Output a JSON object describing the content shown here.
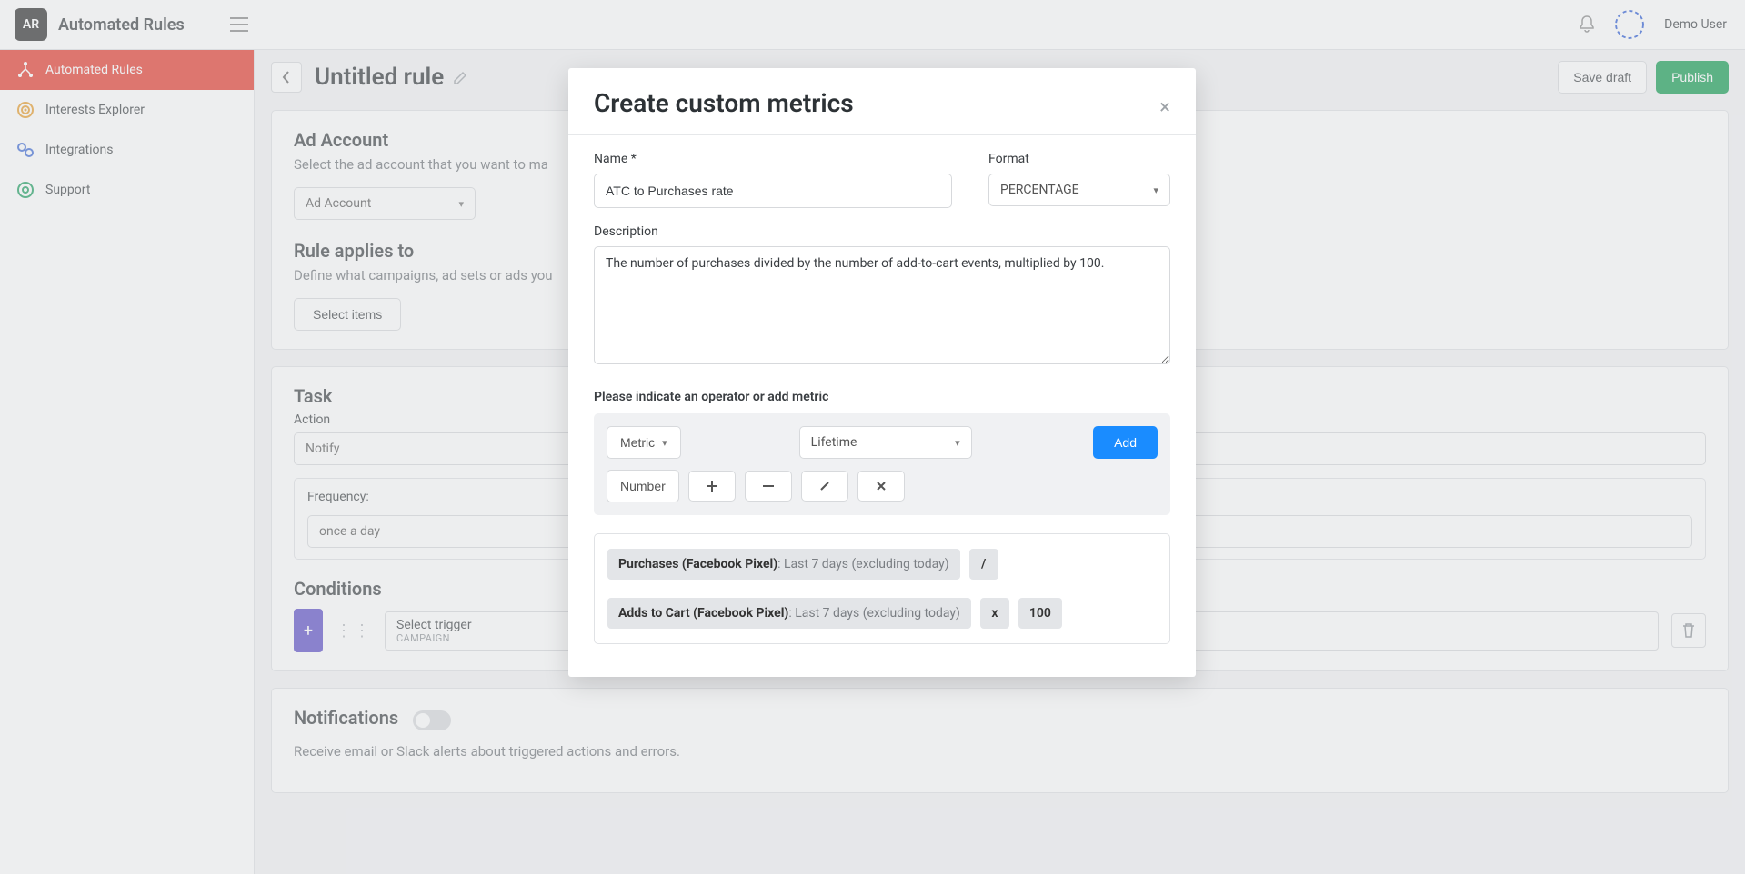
{
  "app": {
    "logo": "AR",
    "title": "Automated Rules",
    "user": "Demo User"
  },
  "sidebar": {
    "items": [
      {
        "label": "Automated Rules"
      },
      {
        "label": "Interests Explorer"
      },
      {
        "label": "Integrations"
      },
      {
        "label": "Support"
      }
    ]
  },
  "page": {
    "title": "Untitled rule",
    "save_draft": "Save draft",
    "publish": "Publish"
  },
  "ad_account": {
    "heading": "Ad Account",
    "hint": "Select the ad account that you want to ma",
    "value": "Ad Account"
  },
  "applies": {
    "heading": "Rule applies to",
    "hint": "Define what campaigns, ad sets or ads you",
    "button": "Select items"
  },
  "task": {
    "heading": "Task",
    "action_label": "Action",
    "action_value": "Notify",
    "freq_label": "Frequency:",
    "freq_value": "once a day"
  },
  "conditions": {
    "heading": "Conditions",
    "trigger_label": "Select trigger",
    "trigger_scope": "CAMPAIGN"
  },
  "notifications": {
    "heading": "Notifications",
    "hint": "Receive email or Slack alerts about triggered actions and errors."
  },
  "modal": {
    "title": "Create custom metrics",
    "name_label": "Name *",
    "name_value": "ATC to Purchases rate",
    "format_label": "Format",
    "format_value": "PERCENTAGE",
    "desc_label": "Description",
    "desc_value": "The number of purchases divided by the number of add-to-cart events, multiplied by 100.",
    "op_label": "Please indicate an operator or add metric",
    "metric_btn": "Metric",
    "timeframe": "Lifetime",
    "add_btn": "Add",
    "number_btn": "Number",
    "formula": {
      "p1_name": "Purchases (Facebook Pixel)",
      "p1_range": ": Last 7 days (excluding today)",
      "op1": "/",
      "p2_name": "Adds to Cart (Facebook Pixel)",
      "p2_range": ": Last 7 days (excluding today)",
      "op2": "x",
      "num": "100"
    }
  }
}
